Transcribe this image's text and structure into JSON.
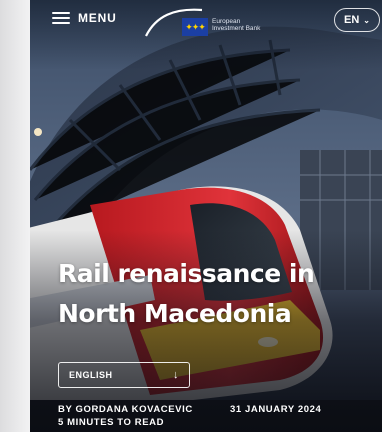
{
  "header": {
    "menu_label": "MENU",
    "logo_text_line1": "European",
    "logo_text_line2": "Investment Bank",
    "language_button": "EN"
  },
  "article": {
    "title_line1": "Rail renaissance in",
    "title_line2": "North Macedonia",
    "language_select": "ENGLISH",
    "author": "BY GORDANA KOVACEVIC",
    "read_time": "5 MINUTES TO READ",
    "date": "31 JANUARY 2024"
  },
  "colors": {
    "train_red": "#d8262e",
    "train_yellow": "#f2c12e",
    "eu_blue": "#1b3fa3"
  },
  "icons": [
    "hamburger-icon",
    "chevron-down-icon",
    "arrow-down-icon"
  ]
}
